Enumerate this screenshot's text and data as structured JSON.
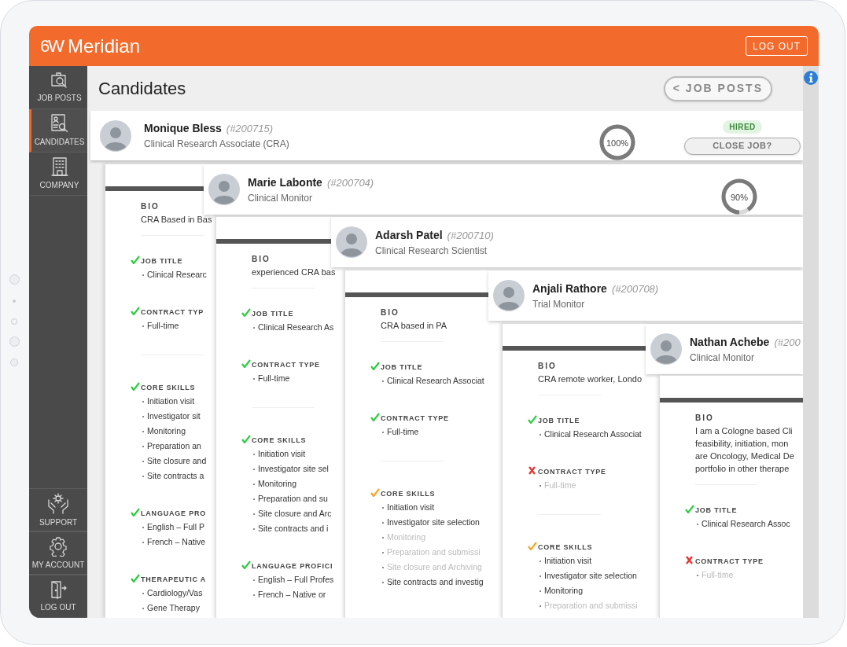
{
  "header": {
    "logo_mark": "6W",
    "brand": "Meridian",
    "logout": "LOG OUT"
  },
  "sidebar": {
    "items": [
      {
        "label": "JOB POSTS",
        "kind": "jobs",
        "selected": false
      },
      {
        "label": "CANDIDATES",
        "kind": "candidates",
        "selected": true
      },
      {
        "label": "COMPANY",
        "kind": "company",
        "selected": false
      }
    ],
    "bottom_items": [
      {
        "label": "SUPPORT",
        "kind": "support"
      },
      {
        "label": "MY ACCOUNT",
        "kind": "account"
      },
      {
        "label": "LOG OUT",
        "kind": "logout"
      }
    ]
  },
  "page": {
    "title": "Candidates",
    "back_button": "< JOB POSTS"
  },
  "hired_candidate": {
    "name": "Monique Bless",
    "id": "(#200715)",
    "role": "Clinical Research Associate (CRA)",
    "level": 1,
    "match_label": "100%",
    "status": "HIRED",
    "action": "CLOSE JOB?"
  },
  "candidate_cards": [
    {
      "name": "Marie Labonte",
      "id": "(#200704)",
      "role": "Clinical Monitor",
      "level": 0.9,
      "match_label": "90%",
      "bio_label": "BIO",
      "bio": [
        "CRA Based in Bas"
      ],
      "sections": [
        {
          "title": "JOB TITLE",
          "matched": true,
          "color": "#2ecc40",
          "items": [
            {
              "text": "Clinical Researc",
              "matched": true
            }
          ]
        },
        {
          "title": "CONTRACT TYP",
          "matched": true,
          "color": "#2ecc40",
          "items": [
            {
              "text": "Full-time",
              "matched": true
            }
          ]
        },
        {
          "title": "CORE SKILLS",
          "matched": true,
          "color": "#2ecc40",
          "items": [
            {
              "text": "Initiation visit",
              "matched": true
            },
            {
              "text": "Investigator sit",
              "matched": true
            },
            {
              "text": "Monitoring",
              "matched": true
            },
            {
              "text": "Preparation an",
              "matched": true
            },
            {
              "text": "Site closure and",
              "matched": true
            },
            {
              "text": "Site contracts a",
              "matched": true
            }
          ]
        },
        {
          "title": "LANGUAGE PRO",
          "matched": true,
          "color": "#2ecc40",
          "items": [
            {
              "text": "English – Full P",
              "matched": true
            },
            {
              "text": "French – Native",
              "matched": true
            }
          ]
        },
        {
          "title": "THERAPEUTIC A",
          "matched": true,
          "color": "#2ecc40",
          "items": [
            {
              "text": "Cardiology/Vas",
              "matched": true
            },
            {
              "text": "Gene Therapy",
              "matched": true
            }
          ]
        }
      ]
    },
    {
      "name": "Adarsh Patel",
      "id": "(#200710)",
      "role": "Clinical Research Scientist",
      "bio_label": "BIO",
      "bio": [
        "experienced CRA bas"
      ],
      "sections": [
        {
          "title": "JOB TITLE",
          "matched": true,
          "color": "#2ecc40",
          "items": [
            {
              "text": "Clinical Research As",
              "matched": true
            }
          ]
        },
        {
          "title": "CONTRACT TYPE",
          "matched": true,
          "color": "#2ecc40",
          "items": [
            {
              "text": "Full-time",
              "matched": true
            }
          ]
        },
        {
          "title": "CORE SKILLS",
          "matched": true,
          "color": "#2ecc40",
          "items": [
            {
              "text": "Initiation visit",
              "matched": true
            },
            {
              "text": "Investigator site sel",
              "matched": true
            },
            {
              "text": "Monitoring",
              "matched": true
            },
            {
              "text": "Preparation and su",
              "matched": true
            },
            {
              "text": "Site closure and Arc",
              "matched": true
            },
            {
              "text": "Site contracts and i",
              "matched": true
            }
          ]
        },
        {
          "title": "LANGUAGE PROFICI",
          "matched": true,
          "color": "#2ecc40",
          "items": [
            {
              "text": "English – Full Profes",
              "matched": true
            },
            {
              "text": "French – Native or",
              "matched": true
            }
          ]
        }
      ]
    },
    {
      "name": "Anjali Rathore",
      "id": "(#200708)",
      "role": "Trial Monitor",
      "bio_label": "BIO",
      "bio": [
        "CRA based in PA"
      ],
      "sections": [
        {
          "title": "JOB TITLE",
          "matched": true,
          "color": "#2ecc40",
          "items": [
            {
              "text": "Clinical Research Associat",
              "matched": true
            }
          ]
        },
        {
          "title": "CONTRACT TYPE",
          "matched": true,
          "color": "#2ecc40",
          "items": [
            {
              "text": "Full-time",
              "matched": true
            }
          ]
        },
        {
          "title": "CORE SKILLS",
          "matched": true,
          "color": "#f5a623",
          "items": [
            {
              "text": "Initiation visit",
              "matched": true
            },
            {
              "text": "Investigator site selection",
              "matched": true
            },
            {
              "text": "Monitoring",
              "matched": false
            },
            {
              "text": "Preparation and submissi",
              "matched": false
            },
            {
              "text": "Site closure and Archiving",
              "matched": false
            },
            {
              "text": "Site contracts and investig",
              "matched": true
            }
          ]
        }
      ]
    },
    {
      "name": "Nathan Achebe",
      "id": "(#200",
      "role": "Clinical Monitor",
      "bio_label": "BIO",
      "bio": [
        "CRA remote worker, Londo"
      ],
      "sections": [
        {
          "title": "JOB TITLE",
          "matched": true,
          "color": "#2ecc40",
          "items": [
            {
              "text": "Clinical Research Associat",
              "matched": true
            }
          ]
        },
        {
          "title": "CONTRACT TYPE",
          "matched": false,
          "color": "#e53935",
          "items": [
            {
              "text": "Full-time",
              "matched": false
            }
          ]
        },
        {
          "title": "CORE SKILLS",
          "matched": true,
          "color": "#f5a623",
          "items": [
            {
              "text": "Initiation visit",
              "matched": true
            },
            {
              "text": "Investigator site selection",
              "matched": true
            },
            {
              "text": "Monitoring",
              "matched": true
            },
            {
              "text": "Preparation and submissi",
              "matched": false
            }
          ]
        }
      ]
    },
    {
      "bio_label": "BIO",
      "bio": [
        "I am a Cologne based Cli",
        "feasibility, initiation, mon",
        "are Oncology, Medical De",
        "portfolio in other therape"
      ],
      "sections": [
        {
          "title": "JOB TITLE",
          "matched": true,
          "color": "#2ecc40",
          "items": [
            {
              "text": "Clinical Research Assoc",
              "matched": true
            }
          ]
        },
        {
          "title": "CONTRACT TYPE",
          "matched": false,
          "color": "#e53935",
          "items": [
            {
              "text": "Full-time",
              "matched": false
            }
          ]
        }
      ]
    }
  ]
}
